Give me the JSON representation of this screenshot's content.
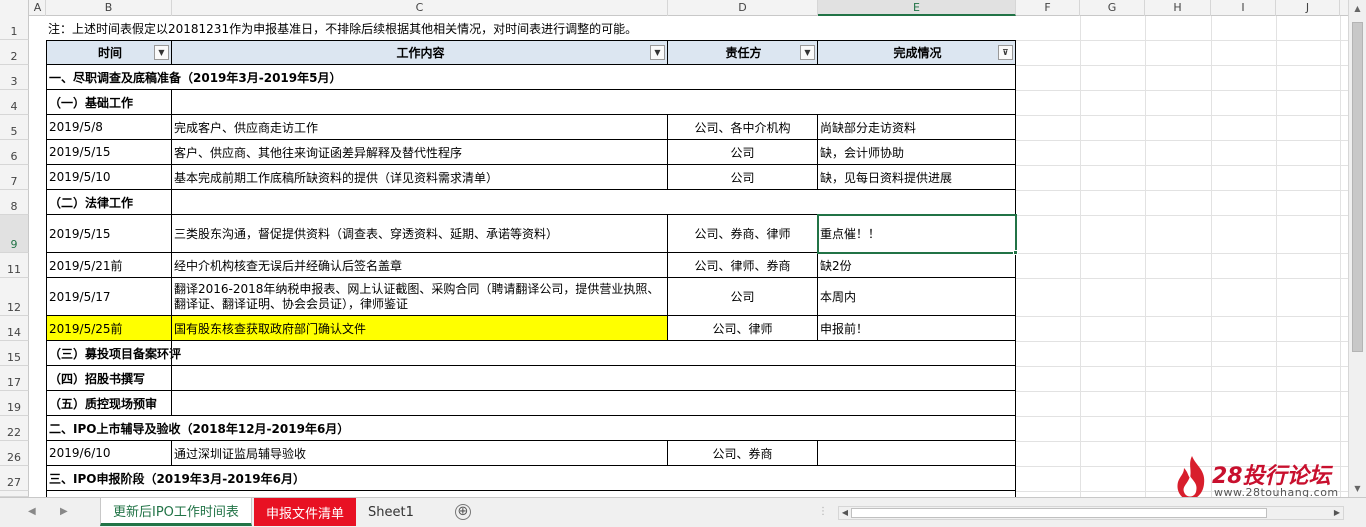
{
  "columns": [
    "A",
    "B",
    "C",
    "D",
    "E",
    "F",
    "G",
    "H",
    "I",
    "J"
  ],
  "selected_column": "E",
  "rows": [
    "1",
    "2",
    "3",
    "4",
    "5",
    "6",
    "7",
    "8",
    "9",
    "11",
    "12",
    "14",
    "15",
    "17",
    "19",
    "22",
    "26",
    "27"
  ],
  "selected_row": "9",
  "note": "注：上述时间表假定以20181231作为申报基准日，不排除后续根据其他相关情况，对时间表进行调整的可能。",
  "headers": {
    "time": "时间",
    "content": "工作内容",
    "owner": "责任方",
    "status": "完成情况"
  },
  "table": {
    "r3": "一、尽职调查及底稿准备（2019年3月-2019年5月）",
    "r4": "（一）基础工作",
    "r5": {
      "date": "2019/5/8",
      "content": "完成客户、供应商走访工作",
      "owner": "公司、各中介机构",
      "status": "尚缺部分走访资料"
    },
    "r6": {
      "date": "2019/5/15",
      "content": "客户、供应商、其他往来询证函差异解释及替代性程序",
      "owner": "公司",
      "status": "缺，会计师协助"
    },
    "r7": {
      "date": "2019/5/10",
      "content": "基本完成前期工作底稿所缺资料的提供（详见资料需求清单）",
      "owner": "公司",
      "status": "缺，见每日资料提供进展"
    },
    "r8": "（二）法律工作",
    "r9": {
      "date": "2019/5/15",
      "content": "三类股东沟通，督促提供资料（调查表、穿透资料、延期、承诺等资料）",
      "owner": "公司、券商、律师",
      "status": "重点催！！"
    },
    "r11": {
      "date": "2019/5/21前",
      "content": "经中介机构核查无误后并经确认后签名盖章",
      "owner": "公司、律师、券商",
      "status": "缺2份"
    },
    "r12": {
      "date": "2019/5/17",
      "content": "翻译2016-2018年纳税申报表、网上认证截图、采购合同（聘请翻译公司，提供营业执照、翻译证、翻译证明、协会会员证），律师鉴证",
      "owner": "公司",
      "status": "本周内"
    },
    "r14": {
      "date": "2019/5/25前",
      "content": "国有股东核查获取政府部门确认文件",
      "owner": "公司、律师",
      "status": "申报前！"
    },
    "r15": "（三）募投项目备案环评",
    "r17": "（四）招股书撰写",
    "r19": "（五）质控现场预审",
    "r22": "二、IPO上市辅导及验收（2018年12月-2019年6月）",
    "r26": {
      "date": "2019/6/10",
      "content": "通过深圳证监局辅导验收",
      "owner": "公司、券商",
      "status": ""
    },
    "r27": "三、IPO申报阶段（2019年3月-2019年6月）"
  },
  "tabs": [
    {
      "label": "更新后IPO工作时间表",
      "state": "active"
    },
    {
      "label": "申报文件清单",
      "state": "red"
    },
    {
      "label": "Sheet1",
      "state": "normal"
    }
  ],
  "add_sheet": "⊕",
  "watermark": {
    "name": "28投行论坛",
    "url": "www.28touhang.com"
  },
  "colors": {
    "header_fill": "#dce6f1",
    "highlight": "#ffff00",
    "excel_green": "#217346",
    "red_tab": "#e81123"
  }
}
